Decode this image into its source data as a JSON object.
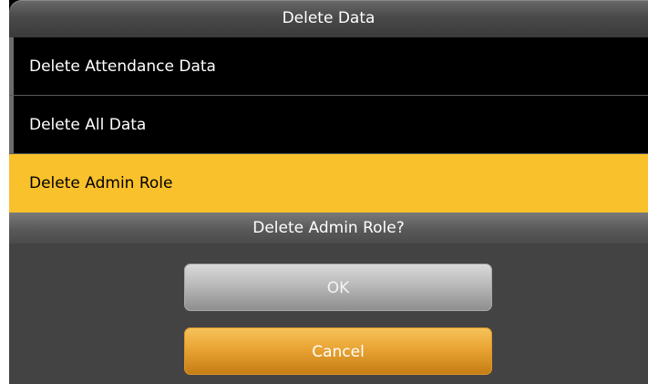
{
  "header": {
    "title": "Delete Data"
  },
  "menu": {
    "items": [
      {
        "label": "Delete Attendance Data"
      },
      {
        "label": "Delete All Data"
      },
      {
        "label": "Delete Admin Role",
        "selected": true
      }
    ]
  },
  "dialog": {
    "message": "Delete Admin Role?",
    "ok_label": "OK",
    "cancel_label": "Cancel"
  },
  "colors": {
    "selected_item": "#f9c12b",
    "ok_button": "#bdbdbd",
    "cancel_button": "#e9a434"
  }
}
